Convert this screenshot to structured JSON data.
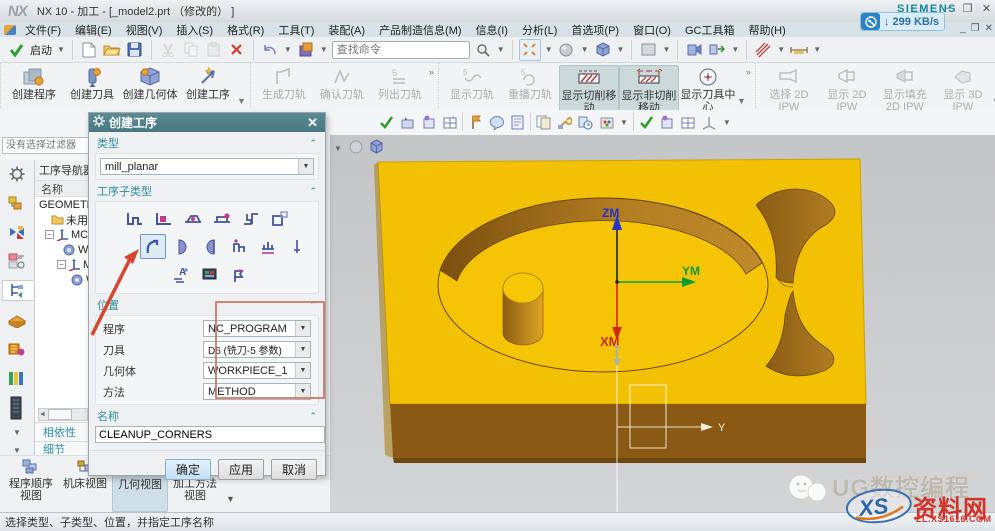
{
  "title_bar": {
    "logo": "NX",
    "title": "NX 10 - 加工 - [_model2.prt （修改的） ]",
    "brand": "SIEMENS",
    "minimize": "–",
    "restore": "❐",
    "close": "✕"
  },
  "net_badge": {
    "text": "↓ 299 KB/s"
  },
  "menu": {
    "items": [
      "文件(F)",
      "编辑(E)",
      "视图(V)",
      "插入(S)",
      "格式(R)",
      "工具(T)",
      "装配(A)",
      "产品制造信息(M)",
      "信息(I)",
      "分析(L)",
      "首选项(P)",
      "窗口(O)",
      "GC工具箱",
      "帮助(H)"
    ]
  },
  "quick_toolbar": {
    "start_label": "启动",
    "search_placeholder": "查找命令"
  },
  "ribbon": {
    "create": [
      "创建程序",
      "创建刀具",
      "创建几何体",
      "创建工序"
    ],
    "toolpath_disabled": [
      "生成刀轨",
      "确认刀轨",
      "列出刀轨"
    ],
    "display_disabled": [
      "显示刀轨",
      "重播刀轨"
    ],
    "display_active": [
      "显示切削移动",
      "显示非切削移动"
    ],
    "tool_center": "显示刀具中心",
    "ipw_disabled": [
      "选择 2D IPW",
      "显示 2D IPW",
      "显示填充 2D IPW",
      "显示 3D IPW"
    ]
  },
  "selection_filter": {
    "placeholder": "没有选择过滤器"
  },
  "navigator": {
    "title": "工序导航器 - 几",
    "column_name": "名称",
    "rows": [
      "GEOMETRY",
      "未用项",
      "MCS_M",
      "WOR",
      "MCS",
      "W"
    ],
    "panels": [
      "相依性",
      "细节"
    ]
  },
  "dialog": {
    "title": "创建工序",
    "section_type": "类型",
    "type_value": "mill_planar",
    "section_subtype": "工序子类型",
    "section_location": "位置",
    "fields": [
      {
        "label": "程序",
        "value": "NC_PROGRAM"
      },
      {
        "label": "刀具",
        "value": "D6 (铣刀-5 参数)"
      },
      {
        "label": "几何体",
        "value": "WORKPIECE_1"
      },
      {
        "label": "方法",
        "value": "METHOD"
      }
    ],
    "section_name": "名称",
    "name_value": "CLEANUP_CORNERS",
    "buttons": {
      "ok": "确定",
      "apply": "应用",
      "cancel": "取消"
    }
  },
  "view_tabs": [
    "程序顺序视图",
    "机床视图",
    "几何视图",
    "加工方法视图"
  ],
  "status_bar": {
    "text": "选择类型、子类型、位置，并指定工序名称"
  },
  "viewport": {
    "axes": {
      "zm": "ZM",
      "ym": "YM",
      "xm": "XM",
      "y": "Y"
    }
  },
  "watermark": {
    "brand": "UG数控编程",
    "stamp_xs": "XS",
    "stamp_name": "资料网",
    "stamp_url": "ZL.XS1616.COM"
  },
  "colors": {
    "dialog_header_teal": "#4e8089",
    "section_label_teal": "#2e8fa3",
    "block_yellow": "#f3c103",
    "block_brown": "#8a5913",
    "annotation_red": "#d9442c",
    "axis_z_blue": "#2233cc",
    "axis_y_green": "#0b9e35",
    "axis_x_red": "#cc2a12"
  }
}
